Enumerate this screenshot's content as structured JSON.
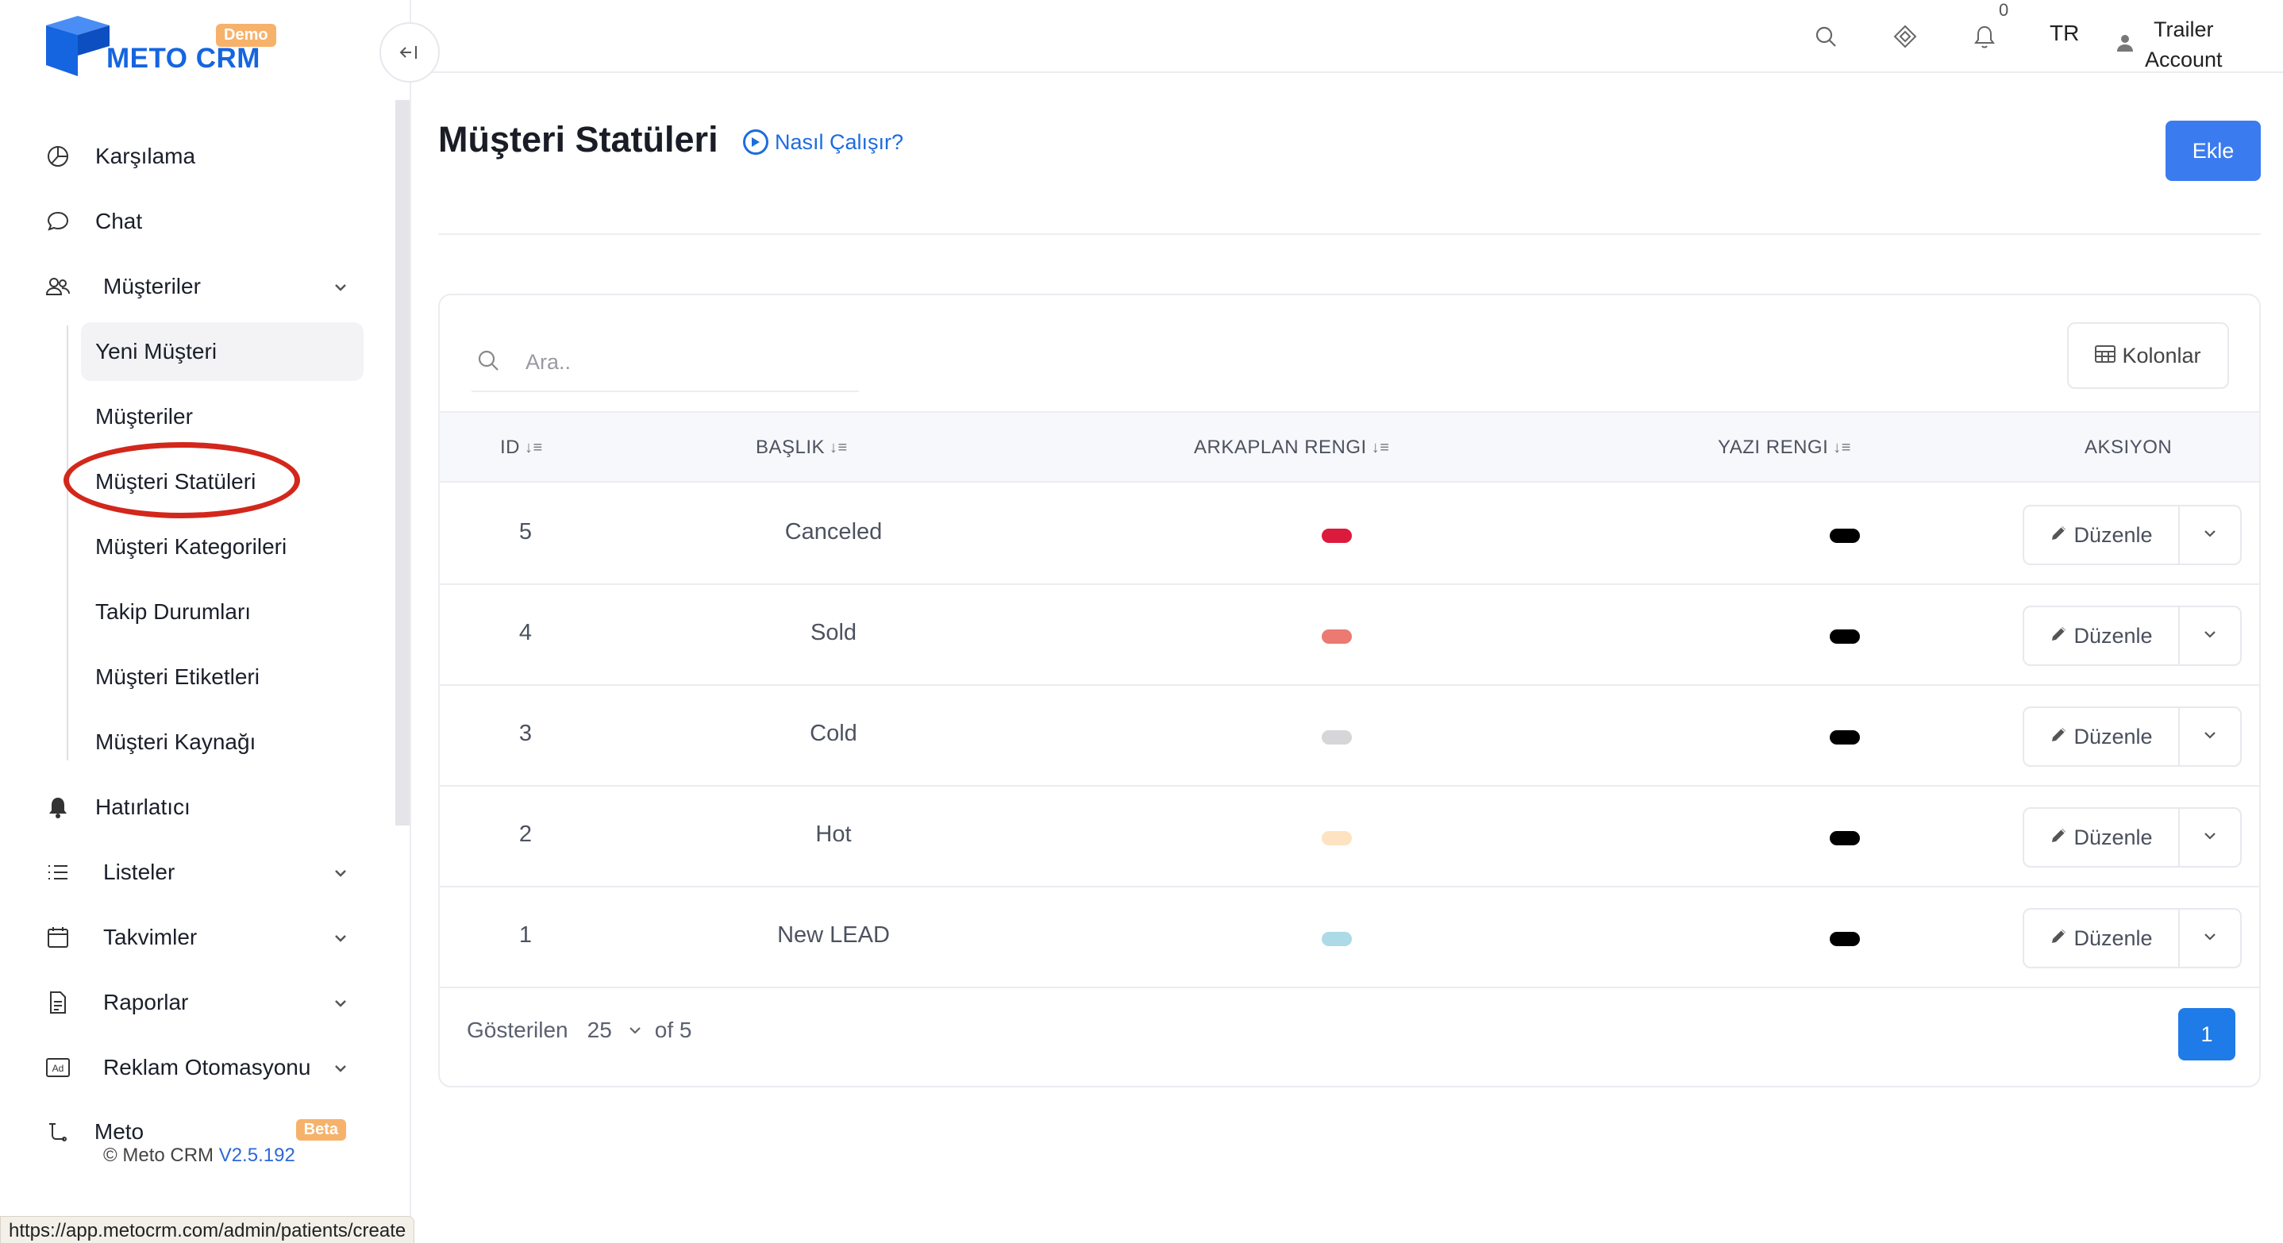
{
  "brand": {
    "name": "METO CRM",
    "badge": "Demo"
  },
  "sidebar": {
    "items": [
      {
        "label": "Karşılama",
        "icon": "pie-chart-icon"
      },
      {
        "label": "Chat",
        "icon": "chat-bubble-icon"
      },
      {
        "label": "Müşteriler",
        "icon": "users-icon"
      },
      {
        "label": "Hatırlatıcı",
        "icon": "bell-icon"
      },
      {
        "label": "Listeler",
        "icon": "list-icon"
      },
      {
        "label": "Takvimler",
        "icon": "calendar-icon"
      },
      {
        "label": "Raporlar",
        "icon": "document-icon"
      },
      {
        "label": "Reklam Otomasyonu",
        "icon": "ad-icon"
      },
      {
        "label": "Meto Otomasyonları",
        "icon": "flow-icon",
        "badge": "Beta"
      }
    ],
    "submenu": [
      "Yeni Müşteri",
      "Müşteriler",
      "Müşteri Statüleri",
      "Müşteri Kategorileri",
      "Takip Durumları",
      "Müşteri Etiketleri",
      "Müşteri Kaynağı"
    ],
    "footer": {
      "copyright": "© Meto CRM",
      "version": "V2.5.192"
    }
  },
  "status_bar_url": "https://app.metocrm.com/admin/patients/create",
  "topbar": {
    "notification_count": "0",
    "language": "TR",
    "user_line1": "Trailer",
    "user_line2": "Account"
  },
  "page": {
    "title": "Müşteri Statüleri",
    "help_link": "Nasıl Çalışır?",
    "add_button": "Ekle"
  },
  "table": {
    "search_placeholder": "Ara..",
    "columns_button": "Kolonlar",
    "headers": [
      "ID",
      "BAŞLIK",
      "ARKAPLAN RENGI",
      "YAZI RENGI",
      "AKSIYON"
    ],
    "edit_label": "Düzenle",
    "rows": [
      {
        "id": "5",
        "title": "Canceled",
        "bg_color": "#dc1a3c",
        "text_color": "#000000"
      },
      {
        "id": "4",
        "title": "Sold",
        "bg_color": "#ea7a72",
        "text_color": "#000000"
      },
      {
        "id": "3",
        "title": "Cold",
        "bg_color": "#d6d6d8",
        "text_color": "#000000"
      },
      {
        "id": "2",
        "title": "Hot",
        "bg_color": "#fde3c1",
        "text_color": "#000000"
      },
      {
        "id": "1",
        "title": "New LEAD",
        "bg_color": "#acdae6",
        "text_color": "#000000"
      }
    ],
    "footer": {
      "shown_label": "Gösterilen",
      "per_page": "25",
      "of_label": "of 5",
      "current_page": "1"
    }
  }
}
